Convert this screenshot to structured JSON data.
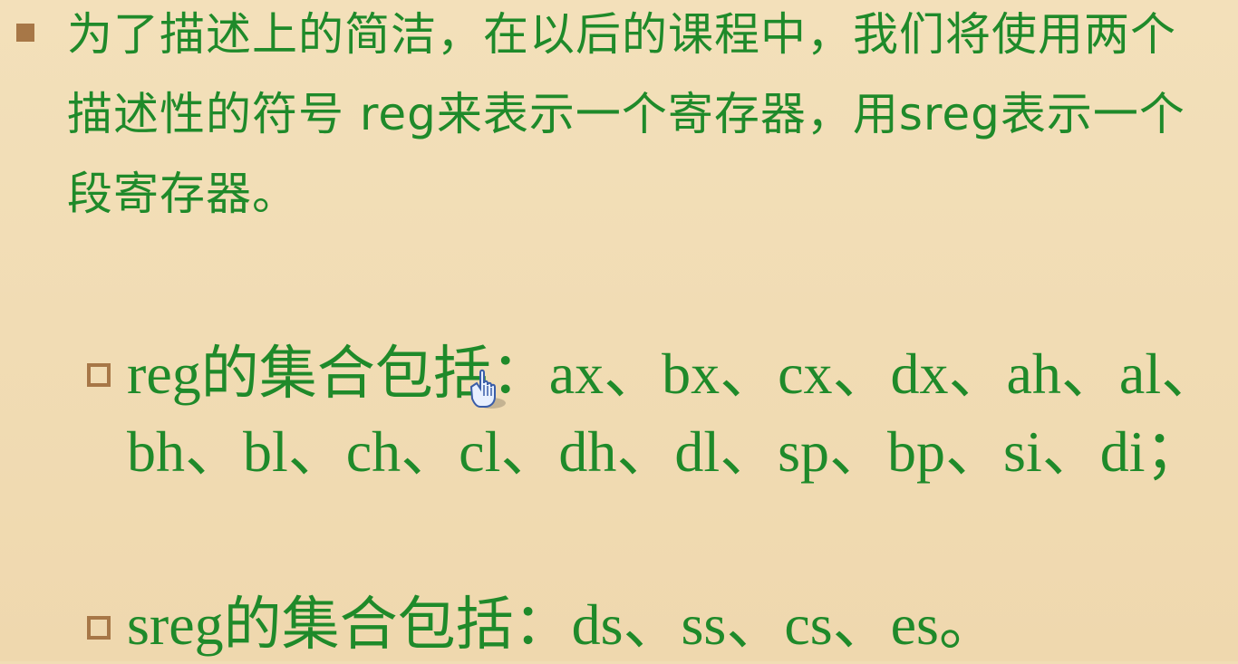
{
  "slide": {
    "main_text": "为了描述上的简洁，在以后的课程中，我们将使用两个描述性的符号 reg来表示一个寄存器，用sreg表示一个段寄存器。",
    "bullets": [
      {
        "text": "reg的集合包括：ax、bx、cx、dx、ah、al、bh、bl、ch、cl、dh、dl、sp、bp、si、di；"
      },
      {
        "text": "sreg的集合包括：ds、ss、cs、es。"
      }
    ]
  },
  "colors": {
    "background": "#f1ddb5",
    "text": "#1f8a2a",
    "bullet": "#a77747"
  },
  "icons": {
    "cursor": "hand-pointer-icon"
  }
}
